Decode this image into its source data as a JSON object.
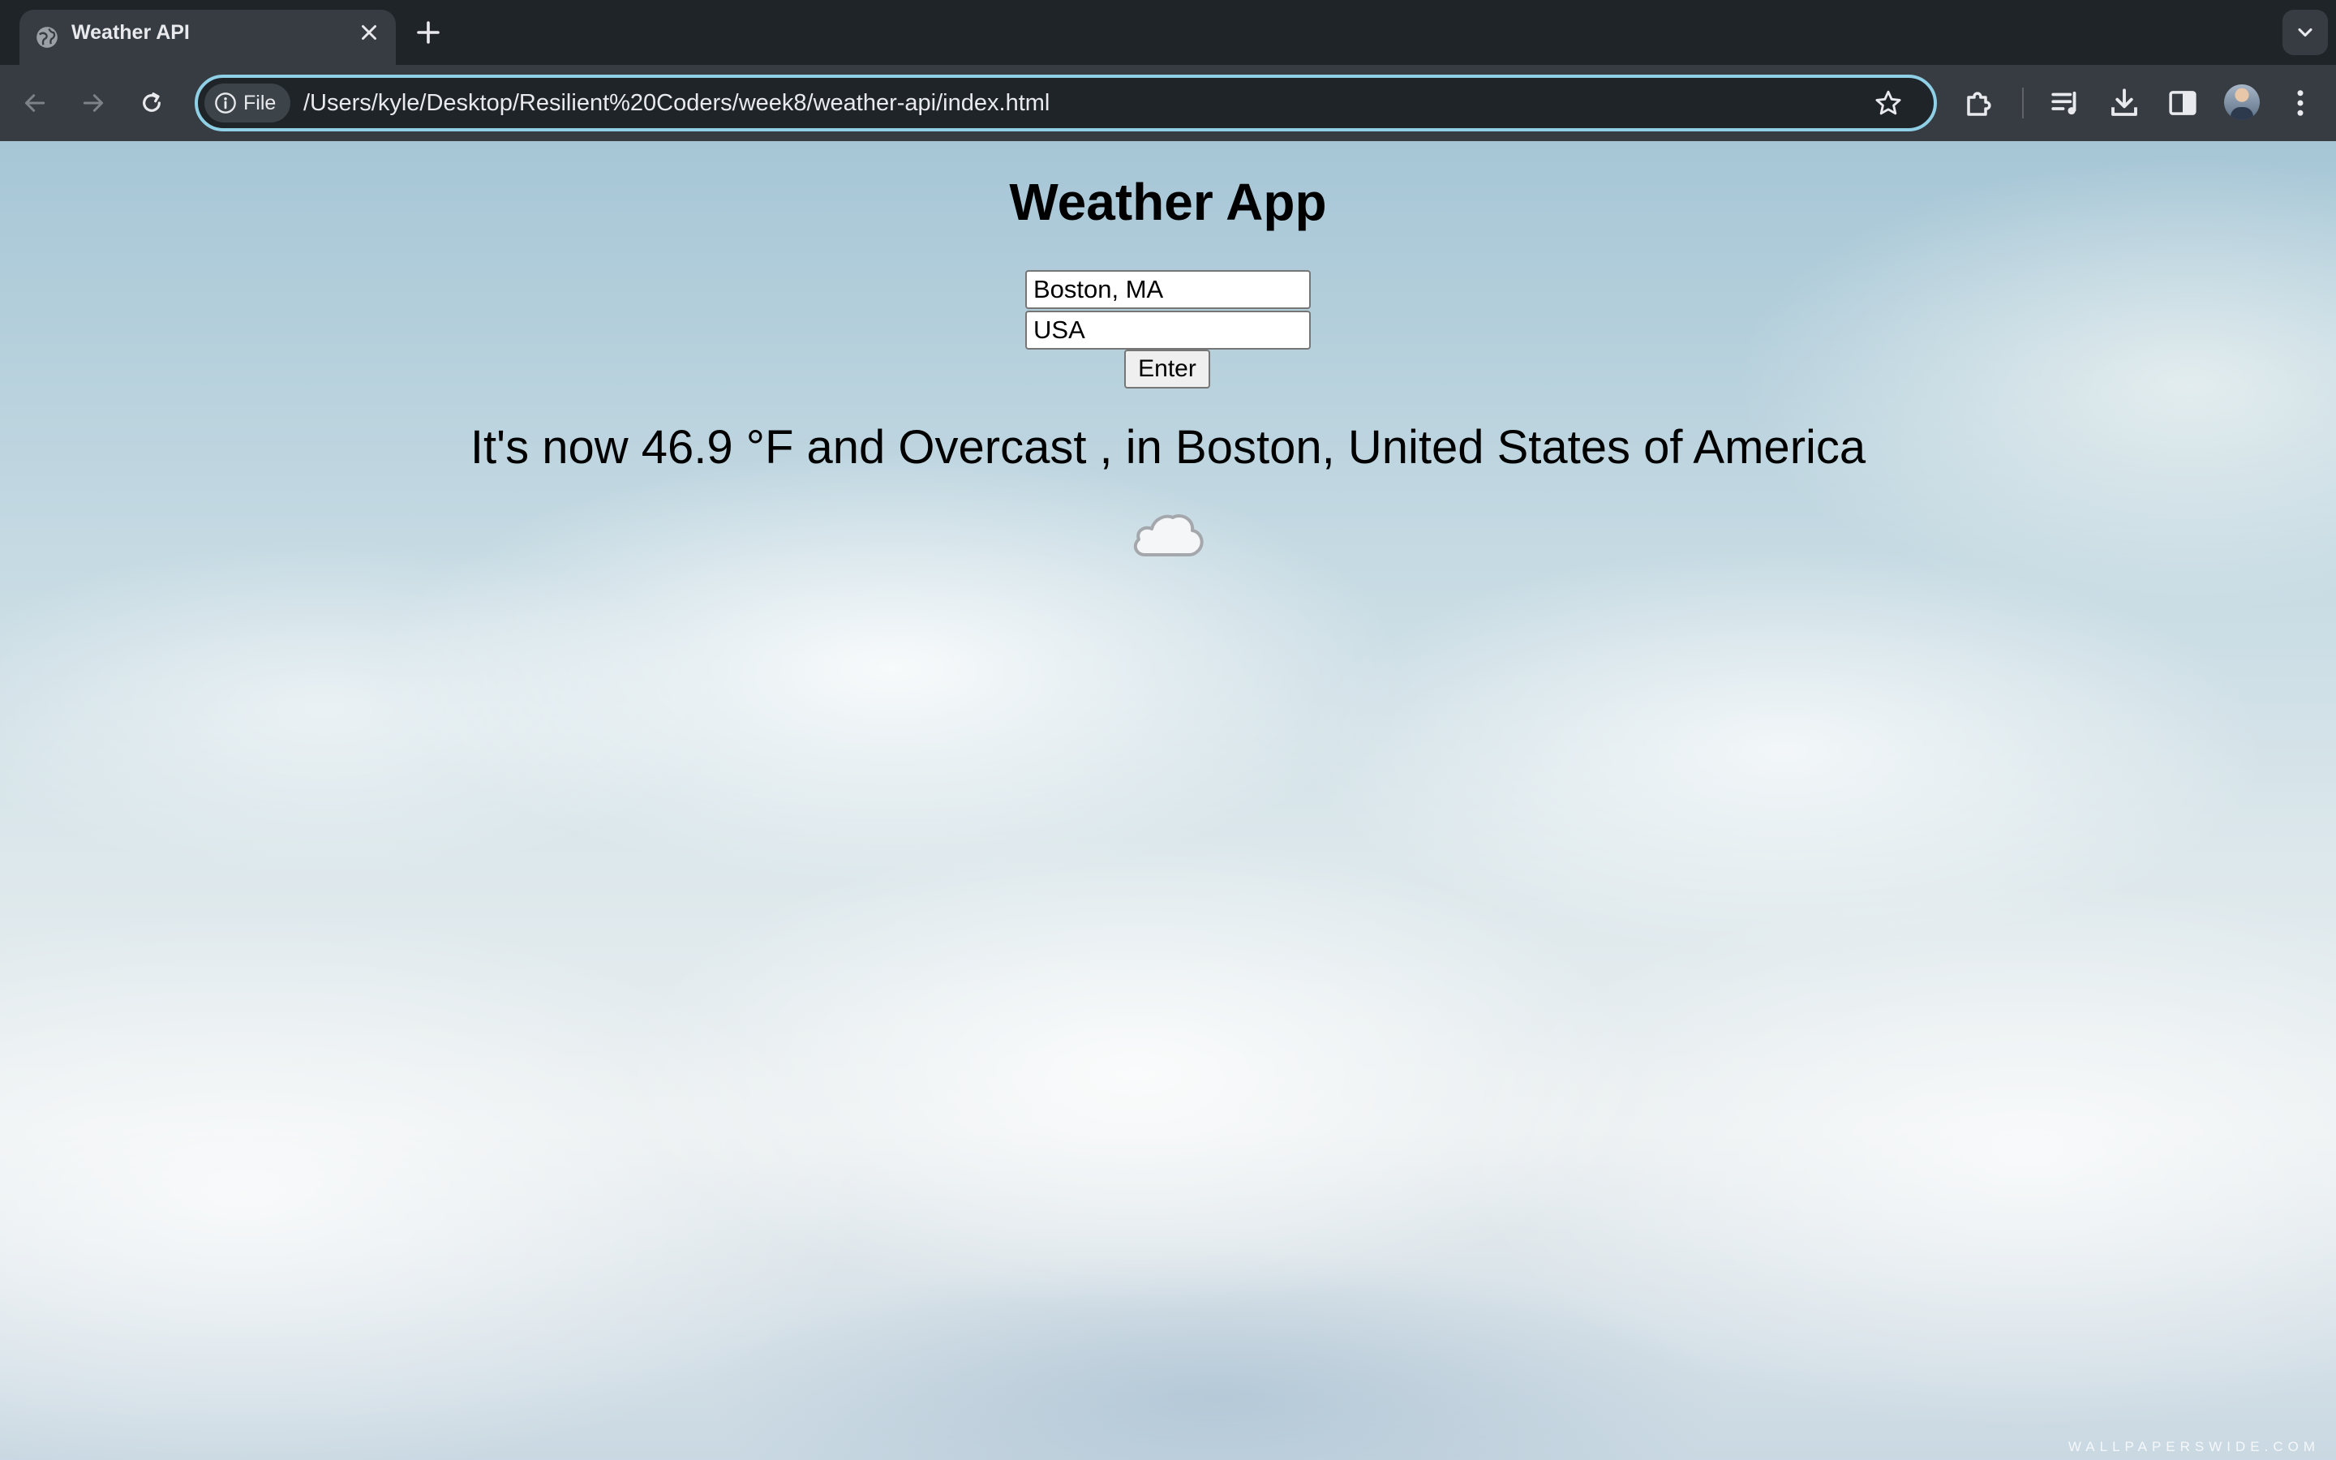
{
  "browser": {
    "tab": {
      "title": "Weather API"
    },
    "address_bar": {
      "chip_label": "File",
      "url": "/Users/kyle/Desktop/Resilient%20Coders/week8/weather-api/index.html"
    },
    "icons": [
      "globe-icon",
      "close-icon",
      "plus-icon",
      "chevron-down-icon",
      "back-arrow-icon",
      "forward-arrow-icon",
      "reload-icon",
      "info-icon",
      "star-icon",
      "puzzle-icon",
      "media-queue-icon",
      "download-icon",
      "side-panel-icon",
      "kebab-menu-icon"
    ]
  },
  "page": {
    "title": "Weather App",
    "city_input": {
      "value": "Boston, MA"
    },
    "country_input": {
      "value": "USA"
    },
    "enter_button": {
      "label": "Enter"
    },
    "weather_message": "It's now 46.9 °F and Overcast , in Boston, United States of America",
    "weather_icon": "cloud-icon",
    "watermark": "WALLPAPERSWIDE.COM"
  },
  "colors": {
    "tab_strip": "#1f2428",
    "toolbar": "#363c42",
    "omnibox_focus_ring": "#8fd0e6",
    "sky": "#a6c6d6"
  }
}
